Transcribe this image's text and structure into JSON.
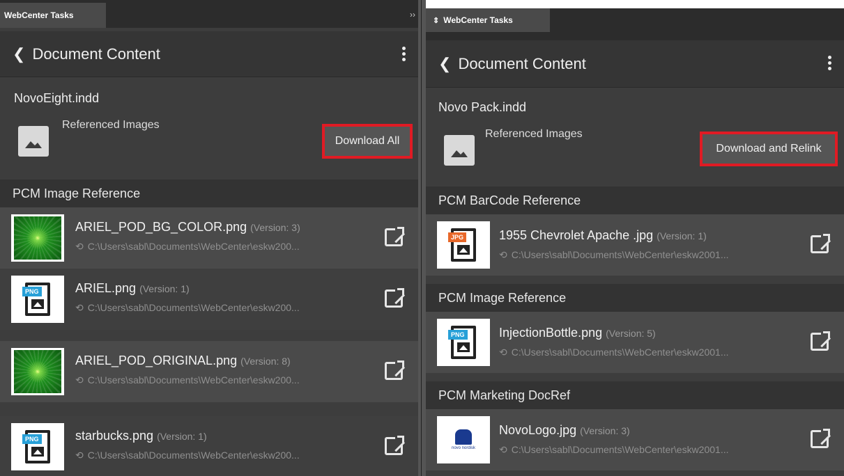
{
  "left": {
    "tab": "WebCenter Tasks",
    "collapse": "››",
    "header_title": "Document Content",
    "doc_name": "NovoEight.indd",
    "ref_label": "Referenced Images",
    "button": "Download All",
    "sections": [
      {
        "title": "PCM Image Reference",
        "items": [
          {
            "name": "ARIEL_POD_BG_COLOR.png",
            "version": "(Version: 3)",
            "path": "C:\\Users\\sabl\\Documents\\WebCenter\\eskw200...",
            "thumb": "green"
          },
          {
            "name": "ARIEL.png",
            "version": "(Version: 1)",
            "path": "C:\\Users\\sabl\\Documents\\WebCenter\\eskw200...",
            "thumb": "PNG"
          },
          {
            "name": "ARIEL_POD_ORIGINAL.png",
            "version": "(Version: 8)",
            "path": "C:\\Users\\sabl\\Documents\\WebCenter\\eskw200...",
            "thumb": "green"
          },
          {
            "name": "starbucks.png",
            "version": "(Version: 1)",
            "path": "C:\\Users\\sabl\\Documents\\WebCenter\\eskw200...",
            "thumb": "PNG"
          }
        ]
      }
    ]
  },
  "right": {
    "tab": "WebCenter Tasks",
    "header_title": "Document Content",
    "doc_name": "Novo Pack.indd",
    "ref_label": "Referenced Images",
    "button": "Download and Relink",
    "sections": [
      {
        "title": "PCM BarCode Reference",
        "items": [
          {
            "name": "1955 Chevrolet Apache .jpg",
            "version": "(Version: 1)",
            "path": "C:\\Users\\sabl\\Documents\\WebCenter\\eskw2001...",
            "thumb": "JPG"
          }
        ]
      },
      {
        "title": "PCM Image Reference",
        "items": [
          {
            "name": "InjectionBottle.png",
            "version": "(Version: 5)",
            "path": "C:\\Users\\sabl\\Documents\\WebCenter\\eskw2001...",
            "thumb": "PNG"
          }
        ]
      },
      {
        "title": "PCM Marketing DocRef",
        "items": [
          {
            "name": "NovoLogo.jpg",
            "version": "(Version: 3)",
            "path": "C:\\Users\\sabl\\Documents\\WebCenter\\eskw2001...",
            "thumb": "novo",
            "logo_text": "novo nordisk"
          }
        ]
      }
    ]
  },
  "colors": {
    "highlight": "#e01b24",
    "png_badge": "#27a0d8",
    "jpg_badge": "#e8682a",
    "panel_bg": "#3d3d3d"
  }
}
